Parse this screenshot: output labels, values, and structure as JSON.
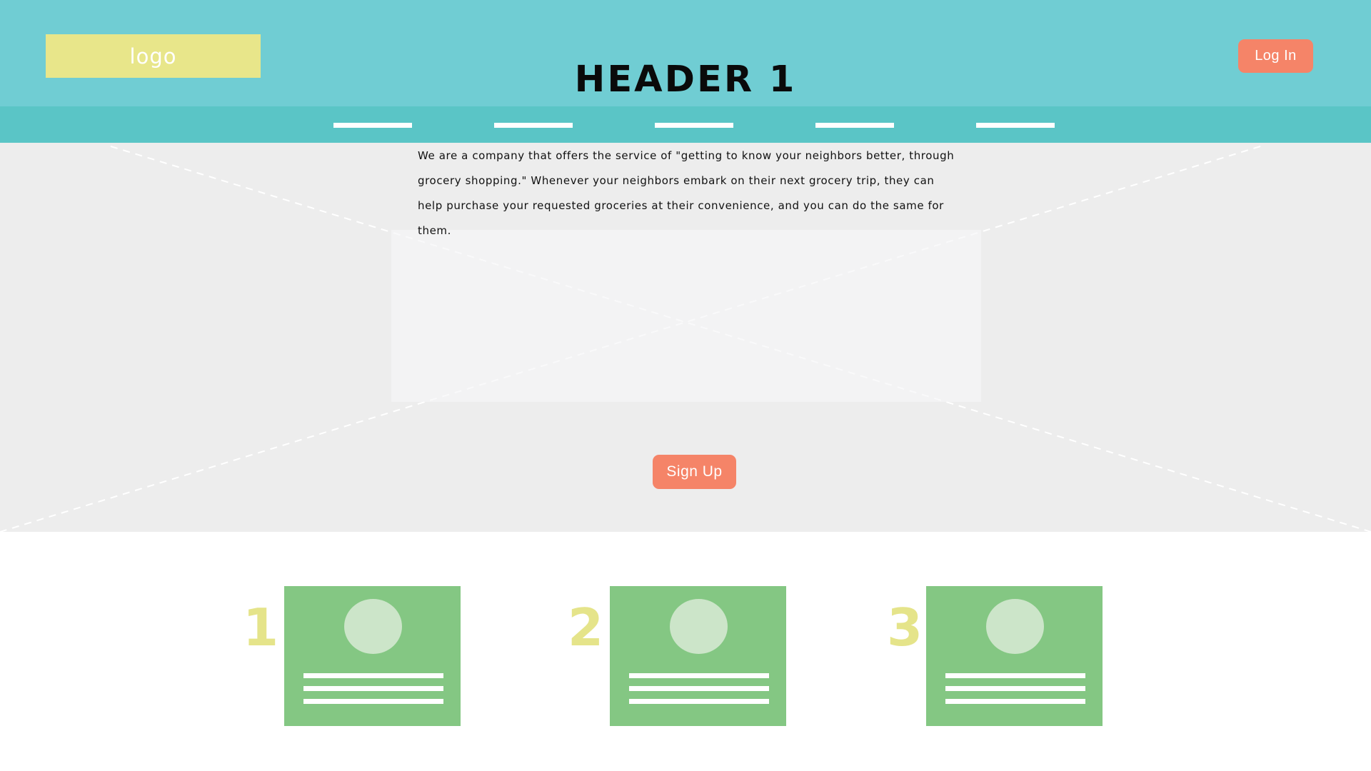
{
  "header": {
    "logo_text": "logo",
    "login_label": "Log In"
  },
  "nav": {
    "items": [
      "",
      "",
      "",
      "",
      ""
    ]
  },
  "hero": {
    "title": "HEADER 1",
    "description": "We are a company that offers the service of \"getting to know your neighbors better, through grocery shopping.\" Whenever your neighbors embark on their next grocery trip, they can help purchase your requested groceries at their convenience, and you can do the same for them.",
    "signup_label": "Sign Up"
  },
  "steps": [
    {
      "number": "1"
    },
    {
      "number": "2"
    },
    {
      "number": "3"
    }
  ],
  "colors": {
    "topbar": "#70cdd3",
    "navbar": "#5ac5c6",
    "logo_bg": "#e8e68a",
    "button": "#f58468",
    "hero_bg": "#ededed",
    "card": "#84c783",
    "card_avatar": "#cce5c9",
    "step_number": "#e5e48a"
  }
}
